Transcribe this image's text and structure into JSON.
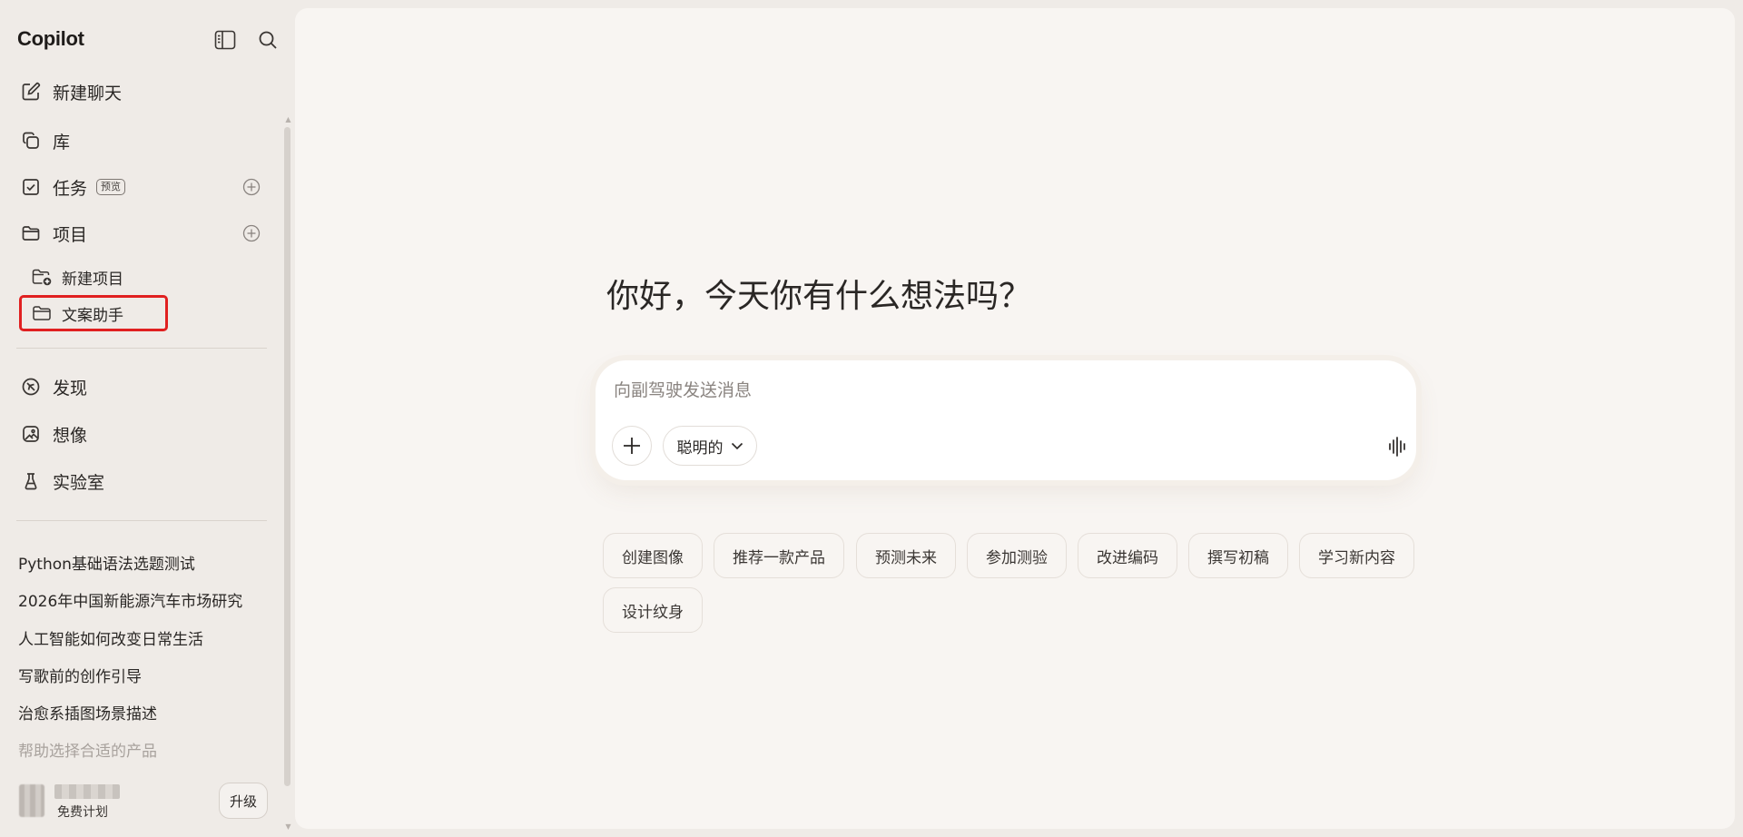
{
  "app": {
    "name": "Copilot"
  },
  "sidebar": {
    "nav": [
      {
        "label": "新建聊天",
        "icon": "new-chat-icon"
      },
      {
        "label": "库",
        "icon": "library-icon"
      },
      {
        "label": "任务",
        "icon": "task-checkbox-icon",
        "badge": "预览"
      },
      {
        "label": "项目",
        "icon": "folder-icon"
      }
    ],
    "projects": [
      {
        "label": "新建项目",
        "icon": "new-folder-icon"
      },
      {
        "label": "文案助手",
        "icon": "folder-icon"
      }
    ],
    "explore": [
      {
        "label": "发现",
        "icon": "compass-icon"
      },
      {
        "label": "想像",
        "icon": "image-icon"
      },
      {
        "label": "实验室",
        "icon": "flask-icon"
      }
    ],
    "history": [
      "Python基础语法选题测试",
      "2026年中国新能源汽车市场研究",
      "人工智能如何改变日常生活",
      "写歌前的创作引导",
      "治愈系插图场景描述",
      "帮助选择合适的产品"
    ],
    "user": {
      "plan": "免费计划",
      "upgrade_label": "升级"
    }
  },
  "main": {
    "greeting": "你好，今天你有什么想法吗？",
    "composer": {
      "placeholder": "向副驾驶发送消息",
      "mode_label": "聪明的"
    },
    "suggestions": [
      "创建图像",
      "推荐一款产品",
      "预测未来",
      "参加测验",
      "改进编码",
      "撰写初稿",
      "学习新内容",
      "设计纹身"
    ]
  },
  "colors": {
    "highlight": "#e02020",
    "background": "#efebe7",
    "main_surface": "#f8f5f2"
  }
}
